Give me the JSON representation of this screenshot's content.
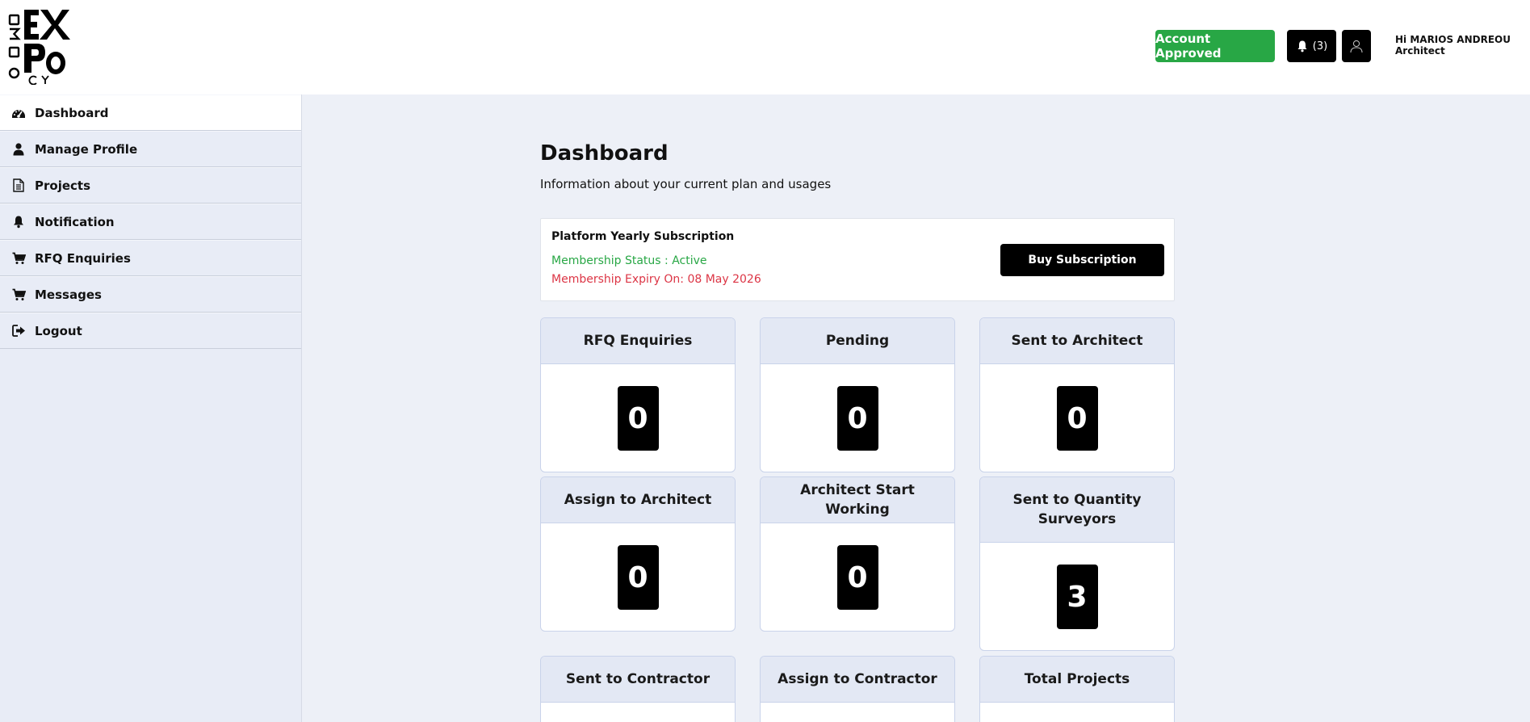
{
  "header": {
    "logo_text": "DOMO EXPO CY",
    "account_status": "Account Approved",
    "notifications_count": "(3)",
    "greeting_name": "Hi MARIOS ANDREOU",
    "greeting_role": "Architect"
  },
  "sidebar": {
    "items": [
      {
        "label": "Dashboard",
        "icon": "dashboard-icon",
        "active": true
      },
      {
        "label": "Manage Profile",
        "icon": "user-icon",
        "active": false
      },
      {
        "label": "Projects",
        "icon": "document-icon",
        "active": false
      },
      {
        "label": "Notification",
        "icon": "bell-icon",
        "active": false
      },
      {
        "label": "RFQ Enquiries",
        "icon": "cart-icon",
        "active": false
      },
      {
        "label": "Messages",
        "icon": "cart-icon",
        "active": false
      },
      {
        "label": "Logout",
        "icon": "logout-icon",
        "active": false
      }
    ]
  },
  "main": {
    "title": "Dashboard",
    "subtitle": "Information about your current plan and usages",
    "subscription": {
      "title": "Platform Yearly Subscription",
      "status": "Membership Status : Active",
      "expiry": "Membership Expiry On: 08 May 2026",
      "buy_label": "Buy Subscription"
    },
    "stats": [
      {
        "label": "RFQ Enquiries",
        "value": "0"
      },
      {
        "label": "Pending",
        "value": "0"
      },
      {
        "label": "Sent to Architect",
        "value": "0"
      },
      {
        "label": "Assign to Architect",
        "value": "0"
      },
      {
        "label": "Architect Start Working",
        "value": "0"
      },
      {
        "label": "Sent to Quantity Surveyors",
        "value": "3"
      },
      {
        "label": "Sent to Contractor",
        "value": ""
      },
      {
        "label": "Assign to Contractor",
        "value": ""
      },
      {
        "label": "Total Projects",
        "value": ""
      }
    ]
  },
  "colors": {
    "approved_green": "#28a745",
    "expiry_red": "#dc3545",
    "sidebar_bg": "#e8ecf6",
    "main_bg": "#edf0f7",
    "card_header_bg": "#e3e8f4"
  }
}
